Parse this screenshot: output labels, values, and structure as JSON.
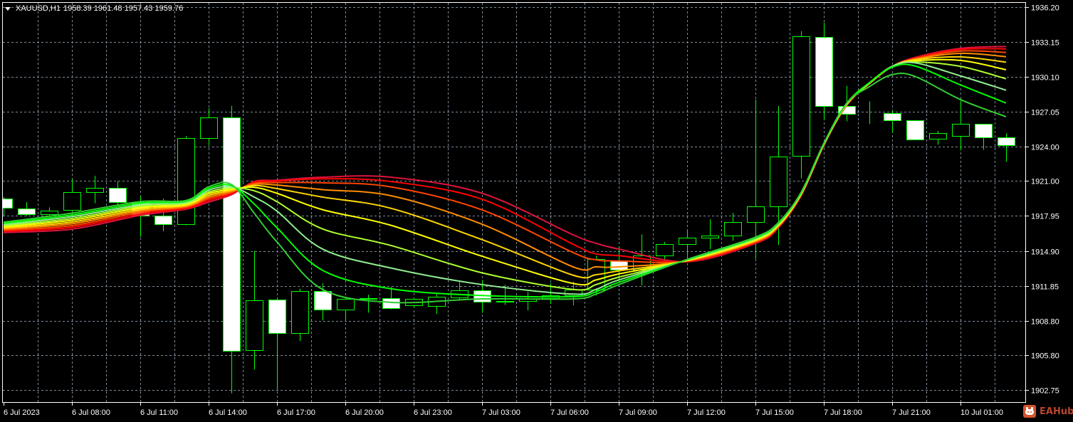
{
  "header": {
    "symbol": "XAUUSD,H1",
    "ohlc": "1958.39 1961.48 1957.43 1959.76"
  },
  "logo": {
    "text": "EAHub"
  },
  "colors": {
    "background": "#000000",
    "grid": "#7b8a99",
    "candle_border": "#00ff00",
    "bull_body": "#000000",
    "bear_body": "#ffffff",
    "axis_text": "#ffffff"
  },
  "chart_data": {
    "type": "candlestick",
    "title": "XAUUSD,H1",
    "ylim": [
      1902.75,
      1936.2
    ],
    "y_ticks": [
      "1936.20",
      "1933.15",
      "1930.10",
      "1927.05",
      "1924.00",
      "1921.00",
      "1917.95",
      "1914.90",
      "1911.85",
      "1908.80",
      "1905.80",
      "1902.75"
    ],
    "x_ticks": [
      {
        "label": "6 Jul 2023",
        "index": 0
      },
      {
        "label": "6 Jul 08:00",
        "index": 3
      },
      {
        "label": "6 Jul 11:00",
        "index": 6
      },
      {
        "label": "6 Jul 14:00",
        "index": 9
      },
      {
        "label": "6 Jul 17:00",
        "index": 12
      },
      {
        "label": "6 Jul 20:00",
        "index": 15
      },
      {
        "label": "6 Jul 23:00",
        "index": 18
      },
      {
        "label": "7 Jul 03:00",
        "index": 21
      },
      {
        "label": "7 Jul 06:00",
        "index": 24
      },
      {
        "label": "7 Jul 09:00",
        "index": 27
      },
      {
        "label": "7 Jul 12:00",
        "index": 30
      },
      {
        "label": "7 Jul 15:00",
        "index": 33
      },
      {
        "label": "7 Jul 18:00",
        "index": 36
      },
      {
        "label": "7 Jul 21:00",
        "index": 39
      },
      {
        "label": "10 Jul 01:00",
        "index": 42
      }
    ],
    "candles": [
      [
        1919.45,
        1919.6,
        1917.97,
        1918.64
      ],
      [
        1918.58,
        1919.16,
        1917.95,
        1918.08
      ],
      [
        1918.08,
        1918.7,
        1917.9,
        1918.4
      ],
      [
        1918.46,
        1921.2,
        1918.3,
        1920.0
      ],
      [
        1920.0,
        1921.46,
        1919.06,
        1920.38
      ],
      [
        1920.38,
        1921.0,
        1918.9,
        1919.16
      ],
      [
        1919.16,
        1919.7,
        1916.13,
        1917.96
      ],
      [
        1917.96,
        1919.47,
        1916.6,
        1917.21
      ],
      [
        1917.21,
        1924.94,
        1917.13,
        1924.74
      ],
      [
        1924.74,
        1927.35,
        1924.13,
        1926.54
      ],
      [
        1926.54,
        1927.56,
        1902.45,
        1906.14
      ],
      [
        1906.2,
        1914.89,
        1904.53,
        1910.56
      ],
      [
        1910.62,
        1910.74,
        1902.7,
        1907.7
      ],
      [
        1907.7,
        1911.59,
        1907.02,
        1911.37
      ],
      [
        1911.37,
        1912.07,
        1908.82,
        1909.75
      ],
      [
        1909.75,
        1910.8,
        1908.84,
        1910.68
      ],
      [
        1910.7,
        1911.06,
        1909.5,
        1910.78
      ],
      [
        1910.75,
        1911.75,
        1909.8,
        1909.88
      ],
      [
        1910.12,
        1910.8,
        1909.9,
        1910.68
      ],
      [
        1910.06,
        1911.12,
        1909.38,
        1910.87
      ],
      [
        1910.81,
        1912.18,
        1910.6,
        1911.43
      ],
      [
        1911.43,
        1912.36,
        1909.5,
        1910.43
      ],
      [
        1910.43,
        1911.93,
        1910.18,
        1910.5
      ],
      [
        1910.49,
        1911.3,
        1909.7,
        1910.68
      ],
      [
        1910.75,
        1912.07,
        1910.25,
        1911.0
      ],
      [
        1911.0,
        1912.2,
        1910.15,
        1911.5
      ],
      [
        1911.5,
        1914.48,
        1911.0,
        1914.17
      ],
      [
        1914.06,
        1915.3,
        1912.3,
        1913.23
      ],
      [
        1913.23,
        1916.34,
        1911.88,
        1914.48
      ],
      [
        1914.48,
        1915.68,
        1913.9,
        1915.47
      ],
      [
        1915.47,
        1916.78,
        1914.23,
        1916.03
      ],
      [
        1916.03,
        1917.65,
        1915.04,
        1916.22
      ],
      [
        1916.22,
        1918.21,
        1915.78,
        1917.4
      ],
      [
        1917.4,
        1928.12,
        1914.2,
        1918.77
      ],
      [
        1918.77,
        1927.56,
        1915.41,
        1923.12
      ],
      [
        1923.18,
        1934.09,
        1921.23,
        1933.63
      ],
      [
        1933.57,
        1934.85,
        1926.36,
        1927.54
      ],
      [
        1927.54,
        1929.32,
        1926.23,
        1926.85
      ],
      [
        1926.85,
        1927.97,
        1925.98,
        1926.85
      ],
      [
        1926.92,
        1927.16,
        1925.24,
        1926.29
      ],
      [
        1926.29,
        1926.29,
        1924.61,
        1924.61
      ],
      [
        1924.68,
        1925.38,
        1924.18,
        1925.17
      ],
      [
        1924.93,
        1928.04,
        1923.68,
        1925.98
      ],
      [
        1925.98,
        1925.98,
        1923.74,
        1924.8
      ],
      [
        1924.8,
        1925.17,
        1922.69,
        1924.12
      ]
    ],
    "ribbon_index": [
      0,
      3,
      6,
      8,
      9,
      10,
      11,
      12,
      14,
      17,
      21,
      25,
      26,
      27,
      30,
      33,
      34,
      35,
      36,
      37,
      38,
      39,
      40,
      42,
      44
    ],
    "ribbon": [
      {
        "name": "ma-1",
        "color": "#32cd32",
        "values": [
          1917.4,
          1918.2,
          1919.2,
          1919.3,
          1920.5,
          1920.7,
          1918.2,
          1915.68,
          1911.53,
          1910.4,
          1910.7,
          1910.7,
          1911.12,
          1911.95,
          1914.15,
          1916.1,
          1917.36,
          1920.0,
          1924.3,
          1927.8,
          1929.25,
          1930.3,
          1930.15,
          1928.12,
          1926.62
        ]
      },
      {
        "name": "ma-2",
        "color": "#00ff00",
        "values": [
          1917.3,
          1918.04,
          1919.07,
          1919.22,
          1920.35,
          1920.6,
          1919.0,
          1916.92,
          1913.2,
          1911.59,
          1911.0,
          1910.9,
          1911.33,
          1912.15,
          1914.13,
          1916.04,
          1917.31,
          1919.97,
          1924.28,
          1927.78,
          1929.6,
          1930.95,
          1931.06,
          1929.4,
          1927.82
        ]
      },
      {
        "name": "ma-3",
        "color": "#90ee90",
        "values": [
          1917.2,
          1917.89,
          1918.93,
          1919.13,
          1920.2,
          1920.5,
          1919.6,
          1918.37,
          1915.06,
          1913.4,
          1911.95,
          1911.12,
          1911.53,
          1912.36,
          1914.11,
          1915.98,
          1917.26,
          1919.93,
          1924.26,
          1927.76,
          1929.58,
          1931.02,
          1931.33,
          1930.19,
          1928.94
        ]
      },
      {
        "name": "ma-4",
        "color": "#adff2f",
        "values": [
          1917.1,
          1917.73,
          1918.8,
          1919.05,
          1920.04,
          1920.4,
          1920.15,
          1919.2,
          1916.82,
          1915.37,
          1912.98,
          1911.53,
          1911.95,
          1912.6,
          1914.09,
          1915.92,
          1917.21,
          1919.9,
          1924.23,
          1927.73,
          1929.57,
          1931.02,
          1931.4,
          1931.02,
          1929.94
        ]
      },
      {
        "name": "ma-5",
        "color": "#ffff00",
        "values": [
          1917.0,
          1917.58,
          1918.67,
          1918.96,
          1919.9,
          1920.3,
          1920.45,
          1919.93,
          1918.5,
          1917.13,
          1914.43,
          1912.05,
          1912.36,
          1912.88,
          1914.07,
          1915.86,
          1917.15,
          1919.87,
          1924.21,
          1927.71,
          1929.55,
          1931.01,
          1931.5,
          1931.54,
          1930.73
        ]
      },
      {
        "name": "ma-6",
        "color": "#ffd700",
        "values": [
          1916.9,
          1917.42,
          1918.53,
          1918.88,
          1919.75,
          1920.2,
          1920.6,
          1920.34,
          1919.6,
          1918.62,
          1915.88,
          1912.77,
          1912.82,
          1913.15,
          1914.05,
          1915.8,
          1917.1,
          1919.83,
          1924.19,
          1927.69,
          1929.54,
          1931.01,
          1931.6,
          1931.85,
          1931.39
        ]
      },
      {
        "name": "ma-7",
        "color": "#ff8c00",
        "values": [
          1916.8,
          1917.27,
          1918.4,
          1918.79,
          1919.6,
          1920.1,
          1920.7,
          1920.65,
          1920.25,
          1919.72,
          1917.23,
          1913.5,
          1913.5,
          1913.5,
          1914.03,
          1915.73,
          1917.05,
          1919.8,
          1924.17,
          1927.67,
          1929.53,
          1931.01,
          1931.65,
          1932.16,
          1931.87
        ]
      },
      {
        "name": "ma-8",
        "color": "#ff4500",
        "values": [
          1916.7,
          1917.11,
          1918.27,
          1918.71,
          1919.46,
          1920.0,
          1920.8,
          1920.86,
          1920.85,
          1920.49,
          1918.48,
          1914.75,
          1914.12,
          1914.02,
          1914.0,
          1915.67,
          1917.0,
          1919.77,
          1924.14,
          1927.64,
          1929.52,
          1931.0,
          1931.7,
          1932.36,
          1932.24
        ]
      },
      {
        "name": "ma-9",
        "color": "#ff0000",
        "values": [
          1916.6,
          1916.96,
          1918.13,
          1918.62,
          1919.31,
          1919.9,
          1920.9,
          1921.0,
          1921.2,
          1920.96,
          1919.41,
          1915.47,
          1914.64,
          1914.48,
          1913.97,
          1915.61,
          1916.95,
          1919.73,
          1924.12,
          1927.62,
          1929.51,
          1931.0,
          1931.75,
          1932.5,
          1932.55
        ]
      },
      {
        "name": "ma-10",
        "color": "#dc143c",
        "values": [
          1916.5,
          1916.8,
          1918.0,
          1918.54,
          1919.16,
          1919.8,
          1920.96,
          1921.07,
          1921.34,
          1921.34,
          1919.93,
          1916.3,
          1915.57,
          1915.06,
          1913.95,
          1915.55,
          1916.9,
          1919.7,
          1924.1,
          1927.6,
          1929.5,
          1931.0,
          1931.8,
          1932.6,
          1932.76
        ]
      }
    ]
  }
}
